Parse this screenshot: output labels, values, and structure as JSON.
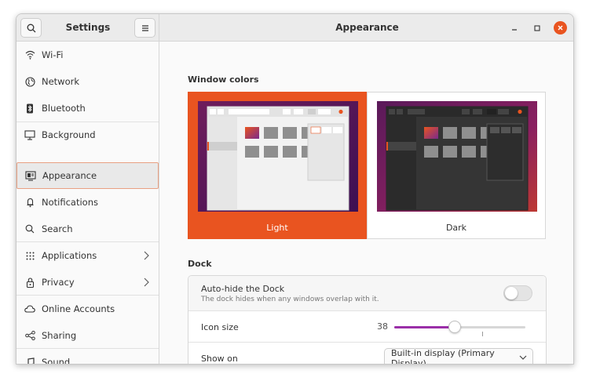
{
  "header": {
    "sidebar_title": "Settings",
    "page_title": "Appearance"
  },
  "sidebar": {
    "items": [
      {
        "label": "Wi-Fi",
        "icon": "wifi-icon"
      },
      {
        "label": "Network",
        "icon": "network-icon"
      },
      {
        "label": "Bluetooth",
        "icon": "bluetooth-icon"
      },
      {
        "label": "Background",
        "icon": "background-icon"
      },
      {
        "label": "Appearance",
        "icon": "appearance-icon",
        "selected": true
      },
      {
        "label": "Notifications",
        "icon": "bell-icon"
      },
      {
        "label": "Search",
        "icon": "search-icon"
      },
      {
        "label": "Applications",
        "icon": "grid-icon"
      },
      {
        "label": "Privacy",
        "icon": "lock-icon"
      },
      {
        "label": "Online Accounts",
        "icon": "cloud-icon"
      },
      {
        "label": "Sharing",
        "icon": "share-icon"
      },
      {
        "label": "Sound",
        "icon": "music-icon"
      }
    ]
  },
  "window_colors": {
    "title": "Window colors",
    "light_label": "Light",
    "dark_label": "Dark",
    "selected": "Light"
  },
  "dock": {
    "title": "Dock",
    "autohide_label": "Auto-hide the Dock",
    "autohide_desc": "The dock hides when any windows overlap with it.",
    "autohide_on": false,
    "icon_size_label": "Icon size",
    "icon_size_value": "38",
    "icon_size_fraction": 0.46,
    "show_on_label": "Show on",
    "show_on_value": "Built-in display (Primary Display)"
  },
  "colors": {
    "accent": "#e95420",
    "slider": "#9b2fa8"
  }
}
